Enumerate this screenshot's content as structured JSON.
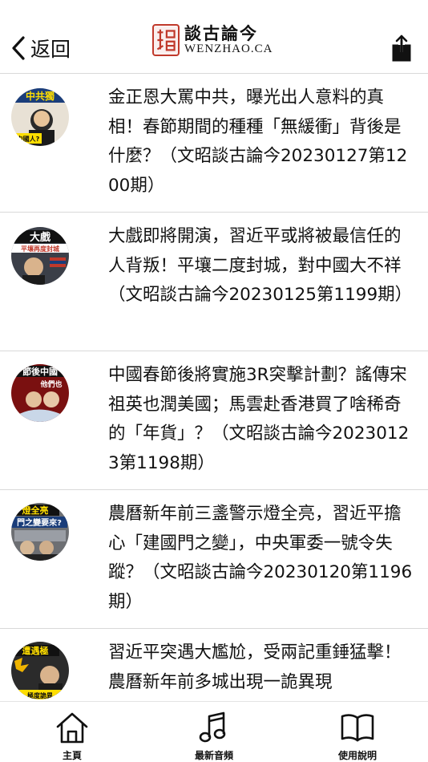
{
  "header": {
    "back_label": "返回",
    "logo_seal_text": "文昭",
    "logo_cn": "談古論今",
    "logo_en": "WENZHAO.CA"
  },
  "articles": [
    {
      "title": "金正恩大罵中共，曝光出人意料的真相！春節期間的種種「無緩衝」背後是什麼？（文昭談古論今20230127第1200期）"
    },
    {
      "title": "大戲即將開演，習近平或將被最信任的人背叛！平壤二度封城，對中國大不祥（文昭談古論今20230125第1199期）"
    },
    {
      "title": "中國春節後將實施3R突擊計劃？謠傳宋祖英也潤美國；馬雲赴香港買了啥稀奇的「年貨」？（文昭談古論今20230123第1198期）"
    },
    {
      "title": "農曆新年前三盞警示燈全亮，習近平擔心「建國門之變」，中央軍委一號令失蹤？（文昭談古論今20230120第1196期）"
    },
    {
      "title": "習近平突遇大尷尬，受兩記重錘猛擊！農曆新年前多城出現一詭異現"
    }
  ],
  "thumbnails": [
    {
      "caption_top": "中共獨",
      "caption_mid": "中國人?"
    },
    {
      "caption_top": "大戲",
      "caption_mid": "平壤再度封城"
    },
    {
      "caption_top": "節後中國",
      "caption_mid": "他們也"
    },
    {
      "caption_top": "燈全亮",
      "caption_mid": "門之變要來?"
    },
    {
      "caption_top": "遭遇極",
      "caption_mid": "極度詭異"
    }
  ],
  "tabs": {
    "home_label": "主頁",
    "audio_label": "最新音頻",
    "help_label": "使用說明"
  },
  "colors": {
    "accent_red": "#c0392b",
    "divider": "#d9d9d9"
  },
  "icons": {
    "back": "chevron-left-icon",
    "share": "share-icon",
    "home": "home-icon",
    "audio": "music-note-icon",
    "help": "book-icon"
  }
}
